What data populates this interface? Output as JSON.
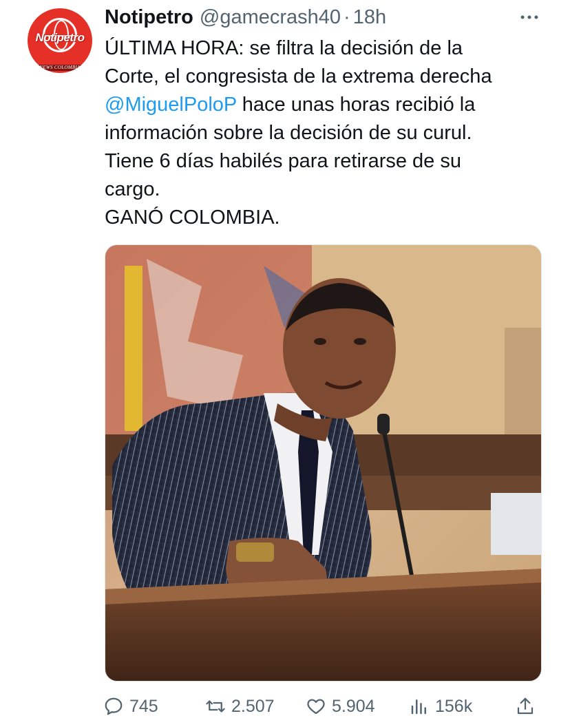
{
  "tweet": {
    "avatar": {
      "brand": "Notipetro",
      "subtitle": "NEWS COLOMBIA"
    },
    "display_name": "Notipetro",
    "handle": "@gamecrash40",
    "separator": "·",
    "time": "18h",
    "more_icon": "more-horizontal-icon",
    "text": {
      "line1": "ÚLTIMA HORA: se filtra la decisión de la",
      "line2": "Corte, el congresista de la extrema derecha",
      "mention": "@MiguelPoloP",
      "line3_rest": " hace unas horas recibió la",
      "line4": "información sobre la decisión de su curul.",
      "line5": "Tiene 6 días habilés para retirarse de su",
      "line6": "cargo.",
      "line7": "GANÓ COLOMBIA."
    },
    "media": {
      "description_icon": "photo"
    },
    "actions": {
      "replies": "745",
      "retweets": "2.507",
      "likes": "5.904",
      "views": "156k"
    }
  },
  "colors": {
    "text": "#0f1419",
    "secondary": "#536471",
    "mention": "#1d9bf0",
    "avatar_red": "#e53027"
  }
}
